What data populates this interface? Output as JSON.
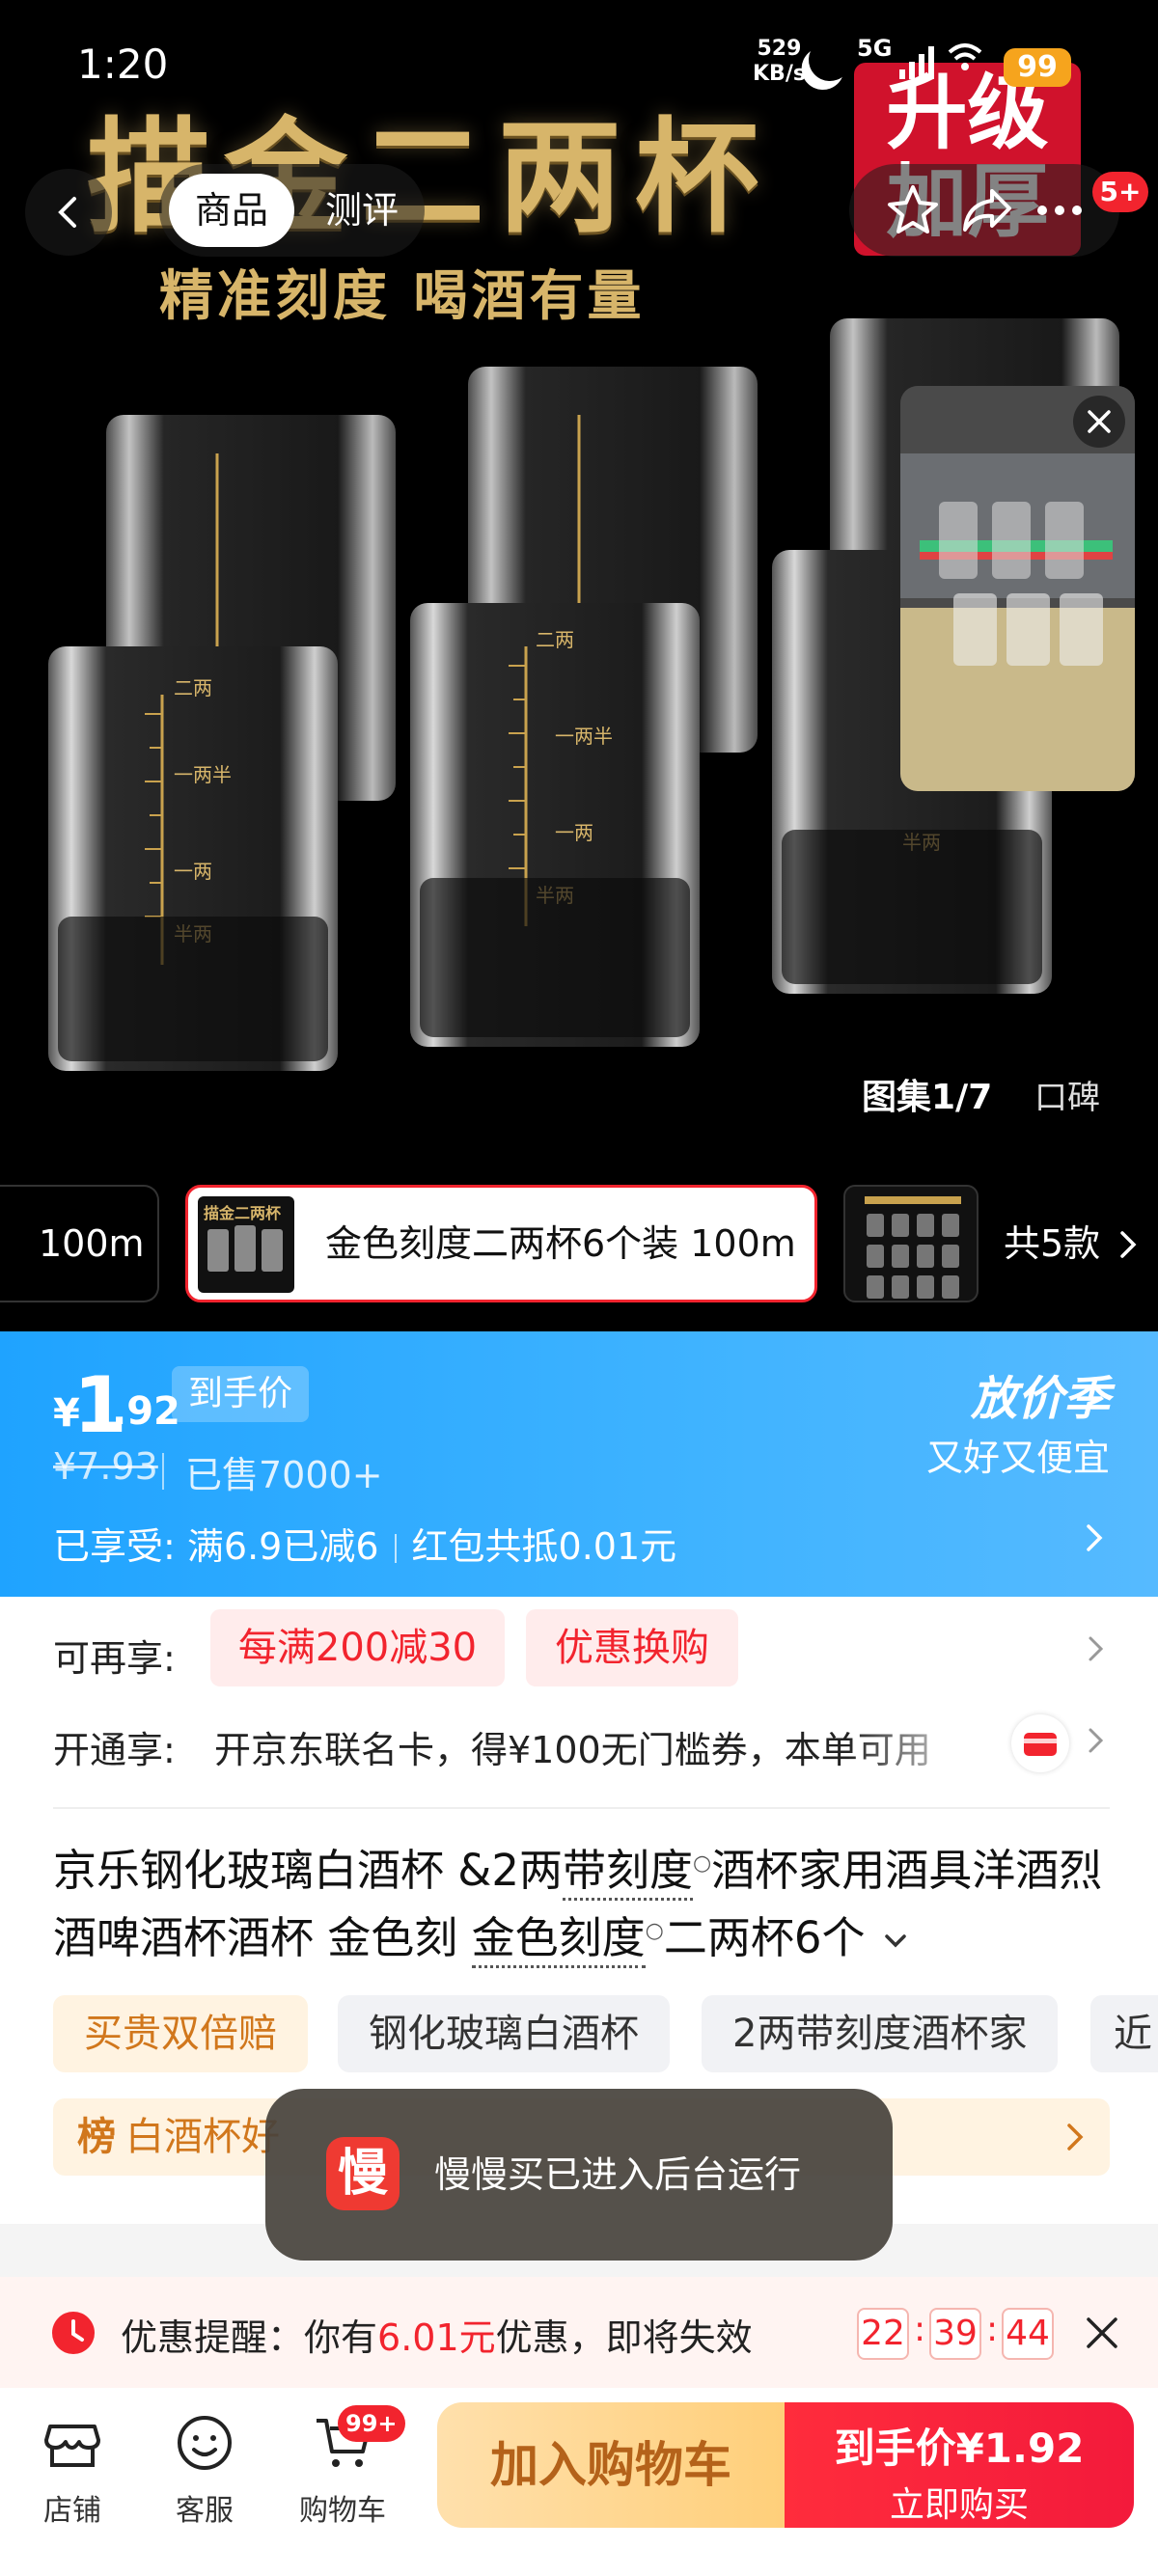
{
  "status": {
    "time": "1:20",
    "speed_value": "529",
    "speed_unit": "KB/s",
    "network": "5G",
    "battery": "99"
  },
  "hero": {
    "title": "描金二两杯",
    "subtitle": "精准刻度  喝酒有量",
    "badge_line1": "升级",
    "badge_line2": "加厚",
    "glass_marks": [
      "二两",
      "一两半",
      "一两",
      "半两"
    ],
    "gallery_counter": "图集1/7",
    "koubei": "口碑"
  },
  "nav": {
    "tabs": [
      {
        "label": "商品",
        "active": true
      },
      {
        "label": "测评",
        "active": false
      }
    ],
    "message_badge": "5+"
  },
  "sku": {
    "prev_label": "100m",
    "active_label": "金色刻度二两杯6个装 100m",
    "thumb_title": "描金二两杯",
    "count": "共5款"
  },
  "price": {
    "currency": "¥",
    "integer": "1",
    "decimal": ".92",
    "tag": "到手价",
    "original": "¥7.93",
    "sold": "已售7000+",
    "promo_title": "放价季",
    "promo_sub": "又好又便宜",
    "enjoyed_prefix": "已享受:",
    "enjoyed_discount": "满6.9已减6",
    "enjoyed_redpacket": "红包共抵0.01元"
  },
  "offers": {
    "label": "可再享:",
    "chips": [
      "每满200减30",
      "优惠换购"
    ],
    "member_label": "开通享:",
    "member_text": "开京东联名卡，得¥100无门槛券，本单可用"
  },
  "product_title": {
    "part1": "京乐钢化玻璃白酒杯 &2两",
    "link1": "带刻度",
    "part2": "酒杯家用酒具洋酒烈酒啤酒杯酒杯 金色刻 ",
    "link2": "金色刻度",
    "part3": "二两杯6个"
  },
  "tags": [
    "买贵双倍赔",
    "钢化玻璃白酒杯",
    "2两带刻度酒杯家",
    "近"
  ],
  "rank": {
    "prefix": "榜",
    "text": "白酒杯好"
  },
  "toast": {
    "icon_char": "慢",
    "text": "慢慢买已进入后台运行"
  },
  "reminder": {
    "prefix": "优惠提醒：你有",
    "amount": "6.01元",
    "suffix": "优惠，即将失效",
    "countdown": [
      "22",
      "39",
      "44"
    ]
  },
  "bottom_bar": {
    "shop": "店铺",
    "service": "客服",
    "cart": "购物车",
    "cart_badge": "99+",
    "add_cart": "加入购物车",
    "buy_price": "到手价¥1.92",
    "buy_label": "立即购买"
  },
  "colors": {
    "accent_red": "#f2242e",
    "price_blue": "#2aa8ff",
    "gold": "#d7b56a"
  }
}
